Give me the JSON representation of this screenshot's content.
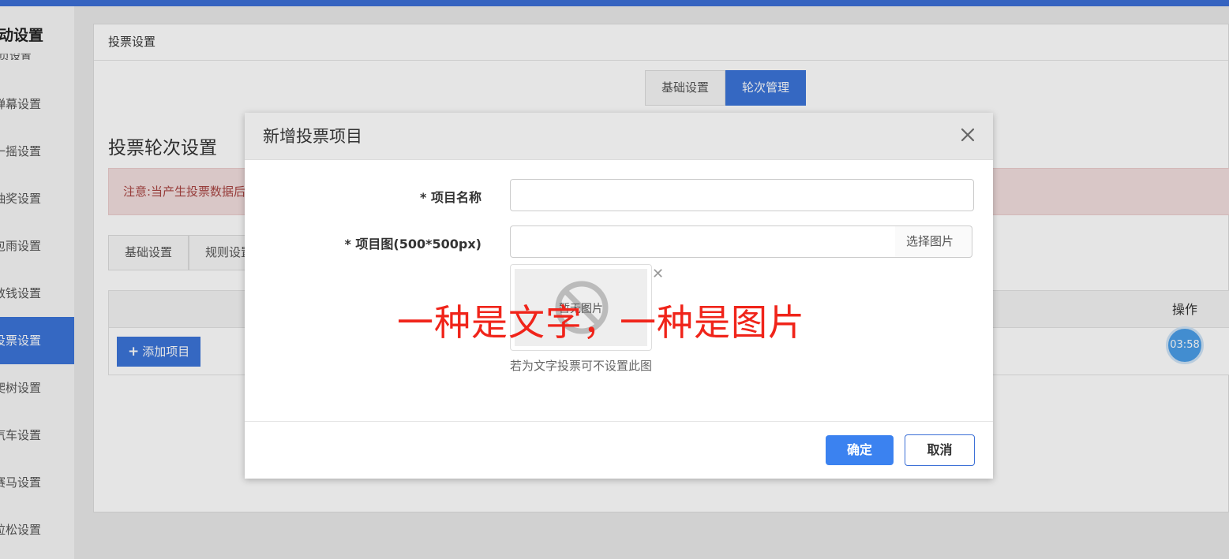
{
  "sidebar": {
    "title": "动设置",
    "cut_item": "页设置",
    "items": [
      {
        "label": "弹幕设置",
        "active": false
      },
      {
        "label": "一摇设置",
        "active": false
      },
      {
        "label": "抽奖设置",
        "active": false
      },
      {
        "label": "包雨设置",
        "active": false
      },
      {
        "label": "数钱设置",
        "active": false
      },
      {
        "label": "投票设置",
        "active": true
      },
      {
        "label": "爬树设置",
        "active": false
      },
      {
        "label": "汽车设置",
        "active": false
      },
      {
        "label": "赛马设置",
        "active": false
      },
      {
        "label": "拉松设置",
        "active": false
      }
    ]
  },
  "card": {
    "header": "投票设置",
    "top_tabs": [
      {
        "label": "基础设置",
        "active": false
      },
      {
        "label": "轮次管理",
        "active": true
      }
    ],
    "section_title": "投票轮次设置",
    "alert": "注意:当产生投票数据后",
    "sub_tabs": [
      "基础设置",
      "规则设置"
    ],
    "table_op_header": "操作",
    "add_button": "添加项目"
  },
  "timer": "03:58",
  "modal": {
    "title": "新增投票项目",
    "name_label": "* 项目名称",
    "name_value": "",
    "image_label": "* 项目图(500*500px)",
    "image_value": "",
    "choose_image": "选择图片",
    "preview_text": "暂无图片",
    "hint": "若为文字投票可不设置此图",
    "ok": "确定",
    "cancel": "取消"
  },
  "annotation": "一种是文字，一种是图片",
  "colors": {
    "primary": "#3b74d9",
    "annotation": "#f0241a",
    "alert_bg": "#f2dede"
  }
}
